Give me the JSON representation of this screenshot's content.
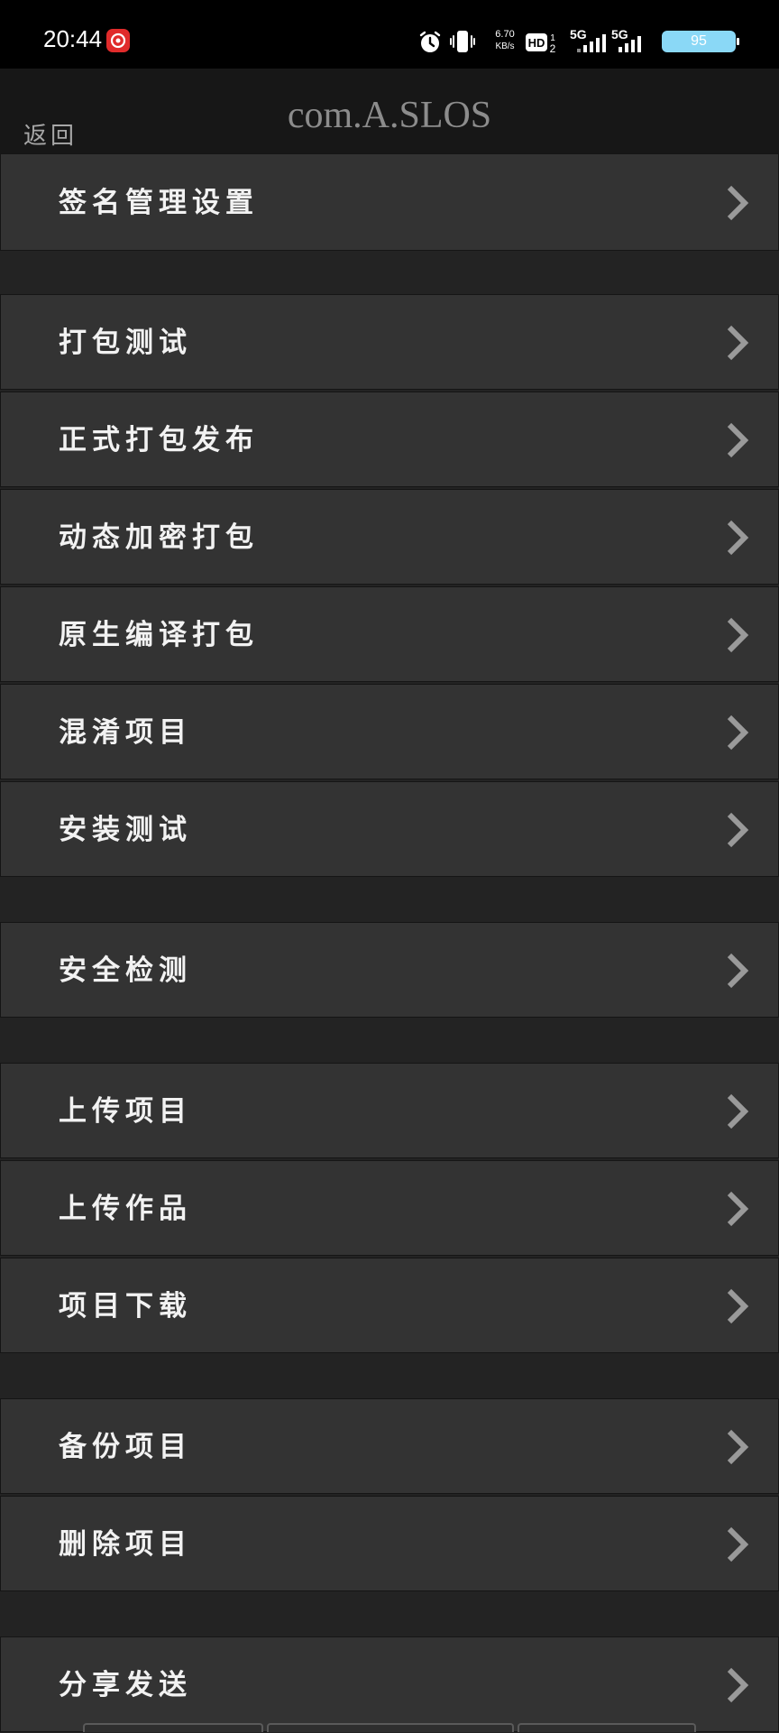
{
  "status_bar": {
    "time": "20:44",
    "net_speed_value": "6.70",
    "net_speed_unit": "KB/s",
    "signal_1": "5G",
    "signal_2": "5G",
    "battery": "95",
    "battery_color": "#8ad8f6",
    "icons": [
      "netease-music-icon",
      "alarm-icon",
      "vibrate-icon",
      "hd-icon",
      "signal-icon",
      "battery-icon"
    ]
  },
  "header": {
    "back_label": "返回",
    "title": "com.A.SLOS"
  },
  "menu": {
    "items": [
      {
        "label": "签名管理设置"
      },
      {
        "label": "打包测试"
      },
      {
        "label": "正式打包发布"
      },
      {
        "label": "动态加密打包"
      },
      {
        "label": "原生编译打包"
      },
      {
        "label": "混淆项目"
      },
      {
        "label": "安装测试"
      },
      {
        "label": "安全检测"
      },
      {
        "label": "上传项目"
      },
      {
        "label": "上传作品"
      },
      {
        "label": "项目下载"
      },
      {
        "label": "备份项目"
      },
      {
        "label": "删除项目"
      },
      {
        "label": "分享发送"
      }
    ]
  },
  "colors": {
    "background": "#232323",
    "row": "#333333",
    "header": "#171717",
    "text": "#f2f2f2",
    "chevron": "#9a9a9a"
  }
}
